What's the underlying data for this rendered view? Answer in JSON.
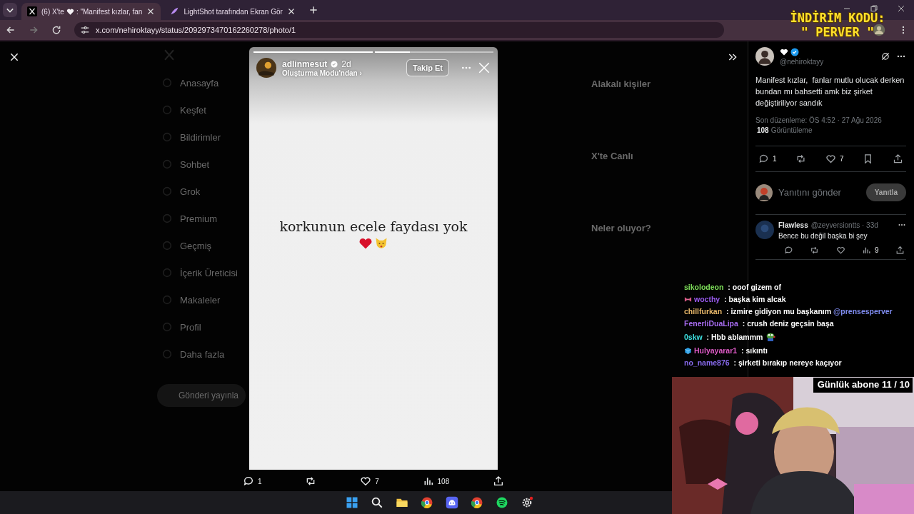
{
  "tabs": [
    {
      "kind": "x",
      "title": "(6) X'te",
      "heart": true,
      "title_rest": ": \"Manifest kızlar, fan",
      "selected": true
    },
    {
      "kind": "feather",
      "title": "LightShot tarafından Ekran Gör",
      "selected": false
    }
  ],
  "address": {
    "url": "x.com/nehiroktayy/status/2092973470162260278/photo/1"
  },
  "promo": [
    "İNDİRİM KODU:",
    "\" PERVER \""
  ],
  "dim_page": {
    "nav": [
      "Anasayfa",
      "Keşfet",
      "Bildirimler",
      "Sohbet",
      "Grok",
      "Premium",
      "Geçmiş",
      "İçerik Üreticisi",
      "Makaleler",
      "Profil",
      "Daha fazla"
    ],
    "post_button": "Gönderi yayınla",
    "headings": [
      "Alakalı kişiler",
      "X'te Canlı",
      "Neler oluyor?"
    ]
  },
  "story": {
    "progress": [
      {
        "level": 1
      },
      {
        "level": 0.3
      }
    ],
    "user": "adlinmesut",
    "time": "2d",
    "subtitle": "Oluşturma Modu'ndan ›",
    "follow": "Takip Et",
    "text": "korkunun ecele faydası yok"
  },
  "media_actions": [
    {
      "kind": "reply",
      "count": "1"
    },
    {
      "kind": "repost"
    },
    {
      "kind": "like",
      "count": "7"
    },
    {
      "kind": "views",
      "count": "108"
    },
    {
      "kind": "share"
    }
  ],
  "tweet": {
    "handle": "@nehiroktayy",
    "text": "Manifest kızlar,  fanlar mutlu olucak derken bundan mı bahsetti amk biz şirket değiştiriliyor sandık",
    "meta": "Son düzenleme: ÖS 4:52 · 27 Ağu 2026",
    "views_count": "108",
    "views_label": "Görüntüleme",
    "actions": [
      {
        "kind": "reply",
        "count": "1"
      },
      {
        "kind": "repost"
      },
      {
        "kind": "like",
        "count": "7"
      },
      {
        "kind": "bookmark"
      },
      {
        "kind": "share"
      }
    ],
    "reply_placeholder": "Yanıtını gönder",
    "reply_button": "Yanıtla",
    "replies": [
      {
        "name": "Flawless",
        "handle": "@zeyversiontts · 33d",
        "text": "Bence bu değil başka bi şey",
        "actions": [
          {
            "kind": "reply"
          },
          {
            "kind": "repost"
          },
          {
            "kind": "like"
          },
          {
            "kind": "views",
            "count": "9"
          },
          {
            "kind": "share"
          }
        ]
      }
    ]
  },
  "chat": [
    {
      "user": "sikolodeon",
      "color": "#7ee05a",
      "message": ": ooof gizem of"
    },
    {
      "user": "wocthy",
      "color": "#9b5cf0",
      "badge": {
        "kind": "bow"
      },
      "message": ": başka kim alcak"
    },
    {
      "user": "chillfurkan",
      "color": "#e8b86a",
      "message": ": izmire gidiyon mu başkanım",
      "mention": "@prensesperver"
    },
    {
      "user": "FenerliDuaLipa",
      "color": "#a76cf0",
      "message": ": crush deniz geçsin başa"
    },
    {
      "user": "0skw",
      "color": "#3ee0e0",
      "message": ": Hbb ablammm",
      "emote": true
    },
    {
      "user": "Hulyayarar1",
      "color": "#e05cc8",
      "badge": {
        "kind": "cube"
      },
      "message": ": sıkıntı"
    },
    {
      "user": "no_name876",
      "color": "#8a6cf0",
      "message": ": şirketi bırakıp nereye kaçıyor"
    }
  ],
  "subs": "Günlük abone 11 / 10"
}
